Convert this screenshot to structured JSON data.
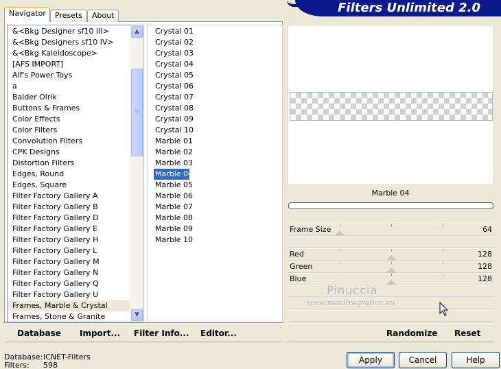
{
  "tabs": [
    {
      "label": "Navigator",
      "active": true
    },
    {
      "label": "Presets",
      "active": false
    },
    {
      "label": "About",
      "active": false
    }
  ],
  "banner_title": "Filters Unlimited 2.0",
  "categories": {
    "items": [
      "&<Bkg Designer sf10 III>",
      "&<Bkg Designers sf10 IV>",
      "&<Bkg Kaleidoscope>",
      "[AFS IMPORT]",
      "Alf's Power Toys",
      "a",
      "Balder Olrik",
      "Buttons & Frames",
      "Color Effects",
      "Color Filters",
      "Convolution Filters",
      "CPK Designs",
      "Distortion Filters",
      "Edges, Round",
      "Edges, Square",
      "Filter Factory Gallery A",
      "Filter Factory Gallery B",
      "Filter Factory Gallery D",
      "Filter Factory Gallery E",
      "Filter Factory Gallery H",
      "Filter Factory Gallery L",
      "Filter Factory Gallery M",
      "Filter Factory Gallery N",
      "Filter Factory Gallery Q",
      "Filter Factory Gallery U",
      "Frames, Marble & Crystal",
      "Frames, Stone & Granite"
    ],
    "selected": "Frames, Marble & Crystal"
  },
  "filters": {
    "items": [
      "Crystal 01",
      "Crystal 02",
      "Crystal 03",
      "Crystal 04",
      "Crystal 05",
      "Crystal 06",
      "Crystal 07",
      "Crystal 08",
      "Crystal 09",
      "Crystal 10",
      "Marble 01",
      "Marble 02",
      "Marble 03",
      "Marble 04",
      "Marble 05",
      "Marble 06",
      "Marble 07",
      "Marble 08",
      "Marble 09",
      "Marble 10"
    ],
    "selected": "Marble 04"
  },
  "preview": {
    "filter_name": "Marble 04",
    "progress": 0
  },
  "parameters": [
    {
      "label": "Frame Size",
      "value": "64",
      "level": 0.25
    },
    {
      "label": "Red",
      "value": "128",
      "level": 0.5
    },
    {
      "label": "Green",
      "value": "128",
      "level": 0.5
    },
    {
      "label": "Blue",
      "value": "128",
      "level": 0.5
    }
  ],
  "watermark": {
    "name": "Pinuccia",
    "url": "www.maidiregrafica.eu"
  },
  "left_toolbar": {
    "database": "Database",
    "import": "Import...",
    "filter_info": "Filter Info...",
    "editor": "Editor..."
  },
  "right_toolbar": {
    "randomize": "Randomize",
    "reset": "Reset"
  },
  "status": {
    "database_label": "Database:",
    "database_value": "ICNET-Filters",
    "filters_label": "Filters:",
    "filters_value": "598"
  },
  "buttons": {
    "apply": "Apply",
    "cancel": "Cancel",
    "help": "Help"
  },
  "icons": {
    "scroll_up": "scroll-up-arrow-icon",
    "scroll_down": "scroll-down-arrow-icon",
    "cursor": "mouse-pointer-icon"
  },
  "colors": {
    "banner": "#0a1a8c",
    "selection": "#316ac5",
    "window_bg": "#ece9d8"
  }
}
